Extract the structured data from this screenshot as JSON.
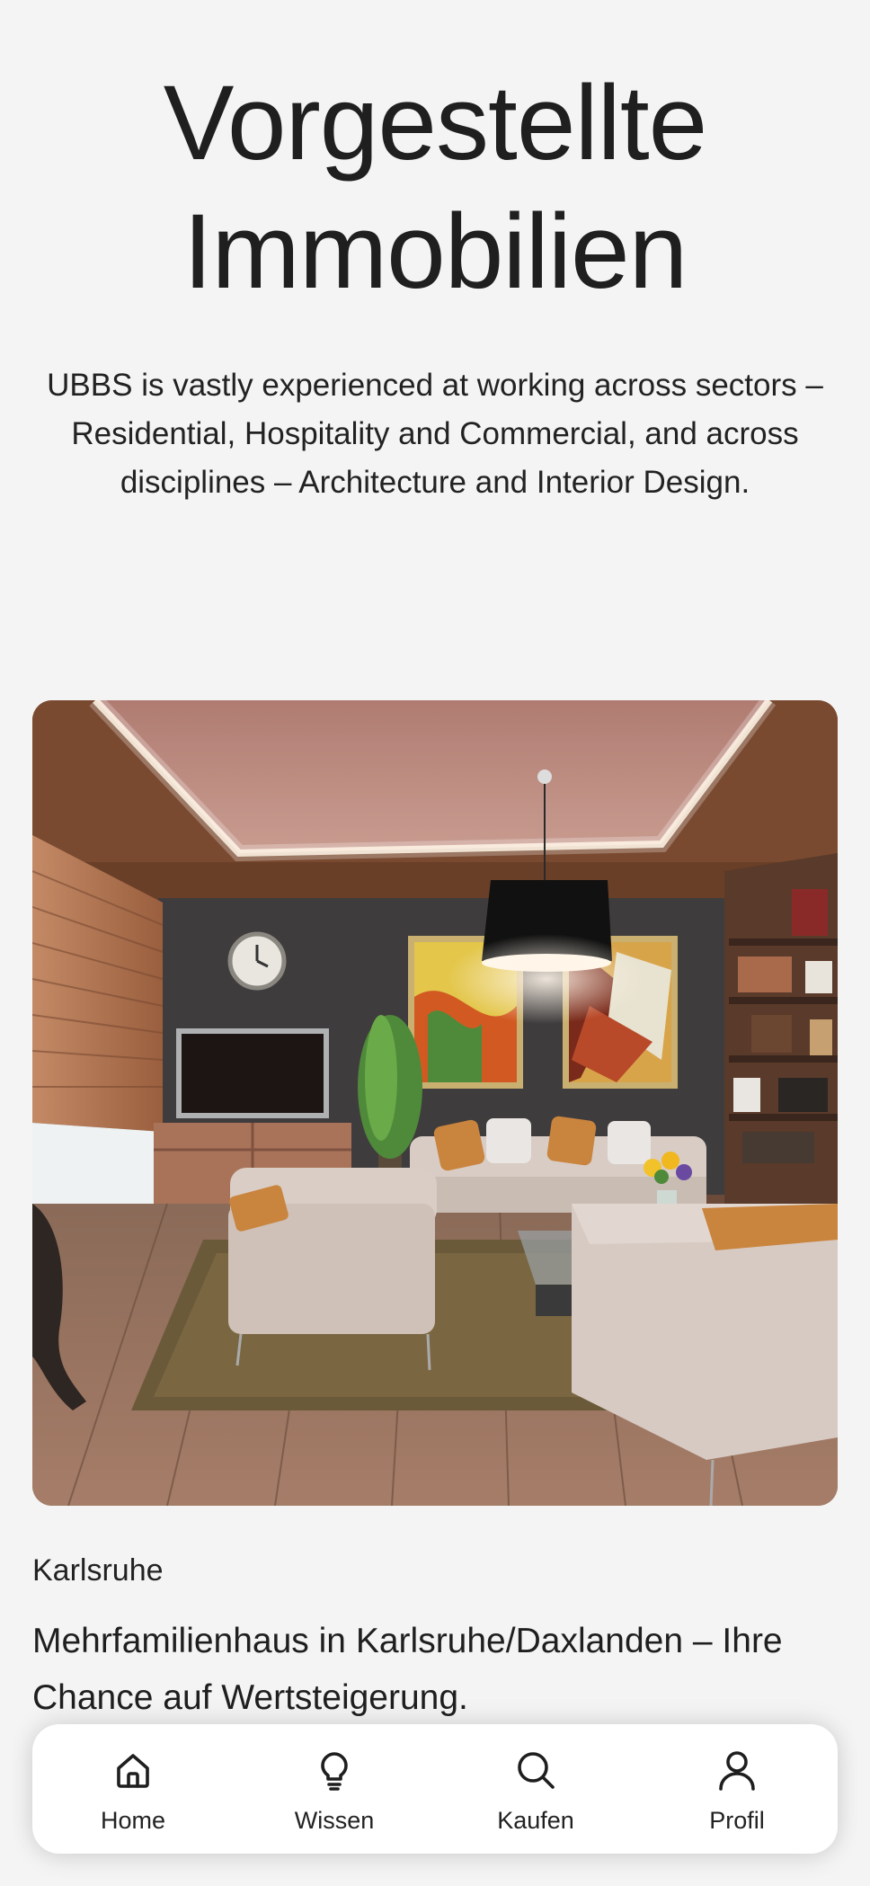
{
  "hero": {
    "title_line1": "Vorgestellte",
    "title_line2": "Immobilien",
    "description": "UBBS is vastly experienced at working across sectors – Residential, Hospitality and Commercial, and across disciplines – Architecture and Interior Design."
  },
  "property": {
    "image_subject": "living-room-interior",
    "location": "Karlsruhe",
    "title": "Mehrfamilienhaus in Karlsruhe/Daxlanden – Ihre Chance auf Wertsteigerung."
  },
  "bottom_nav": {
    "items": [
      {
        "label": "Home",
        "icon": "home-icon"
      },
      {
        "label": "Wissen",
        "icon": "lightbulb-icon"
      },
      {
        "label": "Kaufen",
        "icon": "search-icon"
      },
      {
        "label": "Profil",
        "icon": "user-icon"
      }
    ]
  },
  "colors": {
    "background": "#f4f4f4",
    "nav_background": "#ffffff",
    "text": "#1e1e1e"
  }
}
